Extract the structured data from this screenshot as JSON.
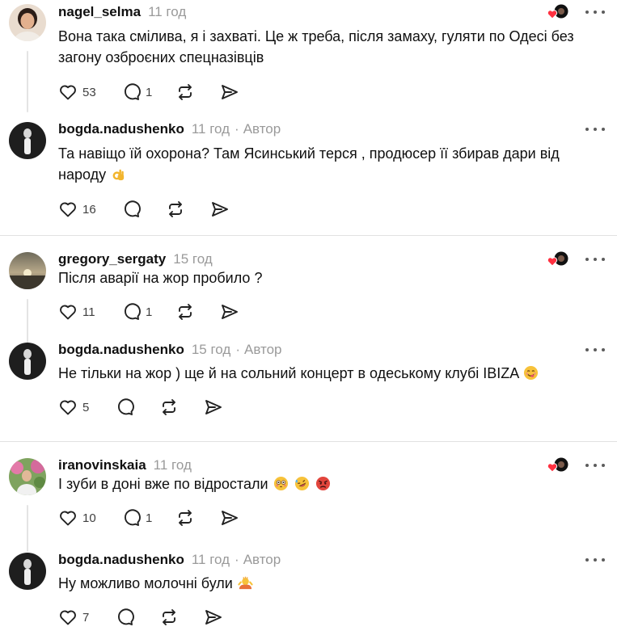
{
  "groups": [
    {
      "comment": {
        "username": "nagel_selma",
        "time": "11 год",
        "text": "Вона така смілива, я і захваті. Це ж треба, після замаху, гуляти по Одесі без загону озброєних спецназівців",
        "likes": "53",
        "replies": "1",
        "has_badge": true
      },
      "reply": {
        "username": "bogda.nadushenko",
        "time": "11 год",
        "author_label": "Автор",
        "text": "Та навіщо їй охорона? Там Ясинський терся , продюсер її збирав дари від народу",
        "emojis": [
          "ok-hand-emoji"
        ],
        "likes": "16"
      }
    },
    {
      "comment": {
        "username": "gregory_sergaty",
        "time": "15 год",
        "text": "Після аварії на жор пробило ?",
        "likes": "11",
        "replies": "1",
        "has_badge": true
      },
      "reply": {
        "username": "bogda.nadushenko",
        "time": "15 год",
        "author_label": "Автор",
        "text": "Не тільки на жор ) ще й на сольний концерт в одеському клубі IBIZA",
        "emojis": [
          "yum-face-emoji"
        ],
        "likes": "5"
      }
    },
    {
      "comment": {
        "username": "iranovinskaia",
        "time": "11 год",
        "text": "І зуби в доні вже по відростали",
        "emojis": [
          "flushed-face-emoji",
          "rofl-face-emoji",
          "angry-face-emoji"
        ],
        "likes": "10",
        "replies": "1",
        "has_badge": true
      },
      "reply": {
        "username": "bogda.nadushenko",
        "time": "11 год",
        "author_label": "Автор",
        "text": "Ну можливо молочні були",
        "emojis": [
          "shrug-emoji"
        ],
        "likes": "7"
      }
    }
  ],
  "icons": {
    "like": "heart-outline-icon",
    "reply": "speech-bubble-icon",
    "repost": "repost-icon",
    "share": "send-icon",
    "more": "more-dots-icon",
    "badge": "liked-by-author-badge"
  },
  "colors": {
    "text": "#101010",
    "muted": "#9a9a9a",
    "heart_red": "#ff3040",
    "divider": "#e2e2e2",
    "thread_line": "#e4e4e4"
  }
}
